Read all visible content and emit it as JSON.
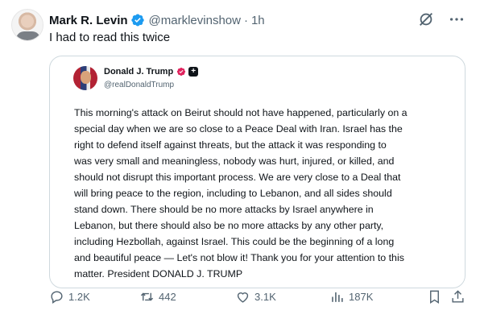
{
  "post": {
    "author_name": "Mark R. Levin",
    "author_handle": "@marklevinshow",
    "separator": "·",
    "time": "1h",
    "text": "I had to read this twice"
  },
  "quote": {
    "author_name": "Donald J. Trump",
    "author_handle": "@realDonaldTrump",
    "lines": [
      "This morning's attack on Beirut should not have happened, particularly on a",
      "special day when we are so close to a Peace Deal with Iran. Israel has the",
      "right to defend itself against threats, but the attack it was responding to",
      "was very small and meaningless, nobody was hurt, injured, or killed, and",
      "should not disrupt this important process. We are very close to a Deal that",
      "will bring peace to the region, including to Lebanon, and all sides should",
      "stand down. There should be no more attacks by Israel anywhere in",
      "Lebanon, but there should also be no more attacks by any other party,",
      "including Hezbollah, against Israel. This could be the beginning of a long",
      "and beautiful peace — Let's not blow it! Thank you for your attention to this",
      "matter. President DONALD J. TRUMP"
    ]
  },
  "actions": {
    "replies": "1.2K",
    "reposts": "442",
    "likes": "3.1K",
    "views": "187K"
  },
  "colors": {
    "verified_blue": "#1d9bf0",
    "verified_gold_pink": "#e0245e",
    "muted_text": "#536471",
    "border": "#cfd9de"
  },
  "icons": [
    "verified-badge-icon",
    "grok-icon",
    "more-icon",
    "reply-icon",
    "repost-icon",
    "like-icon",
    "views-icon",
    "bookmark-icon",
    "share-icon"
  ]
}
